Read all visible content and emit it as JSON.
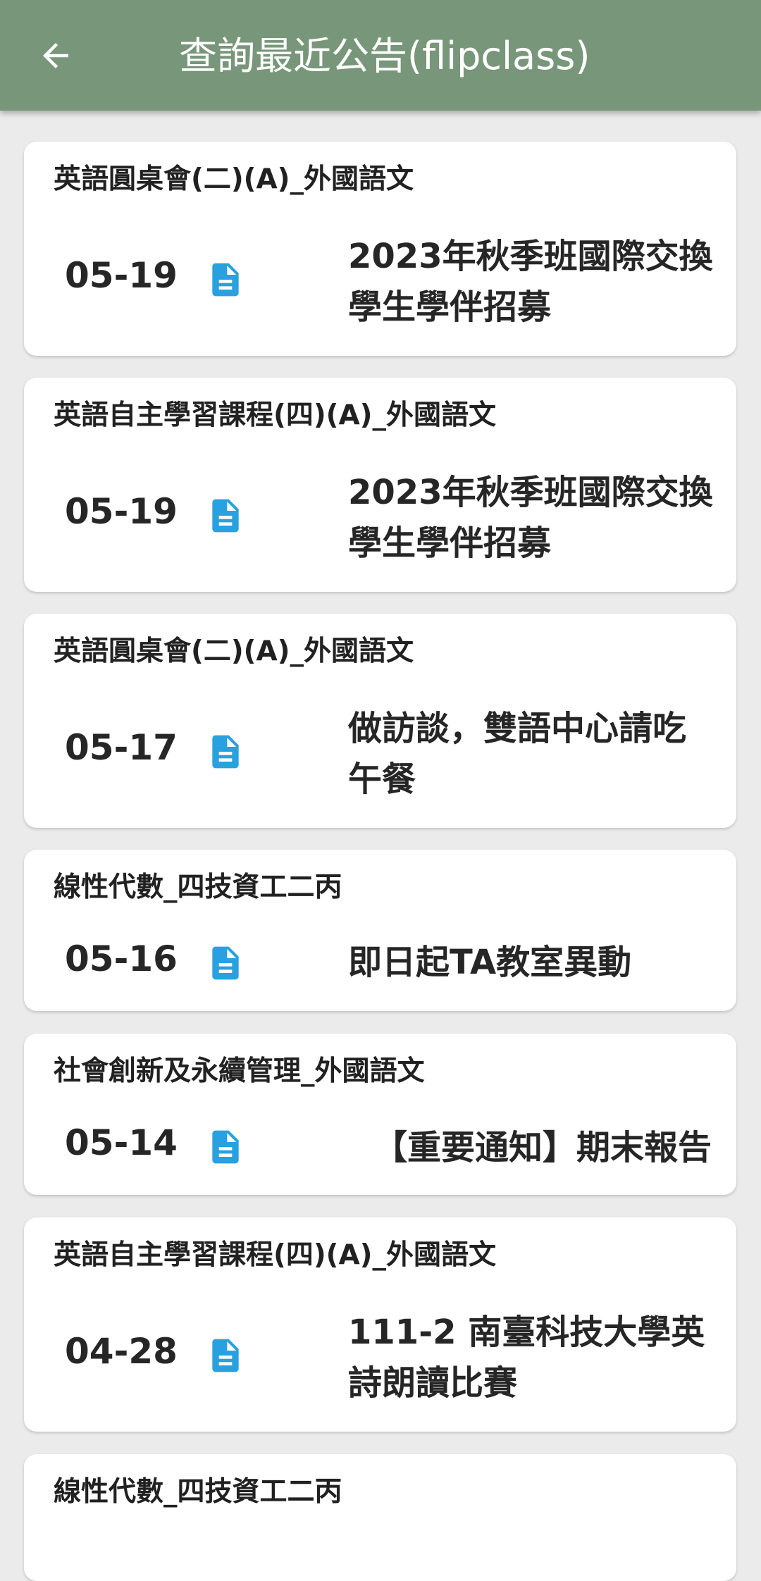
{
  "app_bar": {
    "title": "查詢最近公告(flipclass)",
    "back_icon": "arrow-left-icon",
    "background_color": "#789679"
  },
  "announcements": [
    {
      "course": "英語圓桌會(二)(A)_外國語文",
      "date": "05-19",
      "icon": "document-icon",
      "title": "2023年秋季班國際交換學生學伴招募"
    },
    {
      "course": "英語自主學習課程(四)(A)_外國語文",
      "date": "05-19",
      "icon": "document-icon",
      "title": "2023年秋季班國際交換學生學伴招募"
    },
    {
      "course": "英語圓桌會(二)(A)_外國語文",
      "date": "05-17",
      "icon": "document-icon",
      "title": "做訪談，雙語中心請吃午餐"
    },
    {
      "course": "線性代數_四技資工二丙",
      "date": "05-16",
      "icon": "document-icon",
      "title": "即日起TA教室異動"
    },
    {
      "course": "社會創新及永續管理_外國語文",
      "date": "05-14",
      "icon": "document-icon",
      "title": "【重要通知】期末報告"
    },
    {
      "course": "英語自主學習課程(四)(A)_外國語文",
      "date": "04-28",
      "icon": "document-icon",
      "title": "111-2 南臺科技大學英詩朗讀比賽"
    },
    {
      "course": "線性代數_四技資工二丙",
      "date": "",
      "icon": "",
      "title": ""
    }
  ],
  "icon_color": "#29a1e0"
}
